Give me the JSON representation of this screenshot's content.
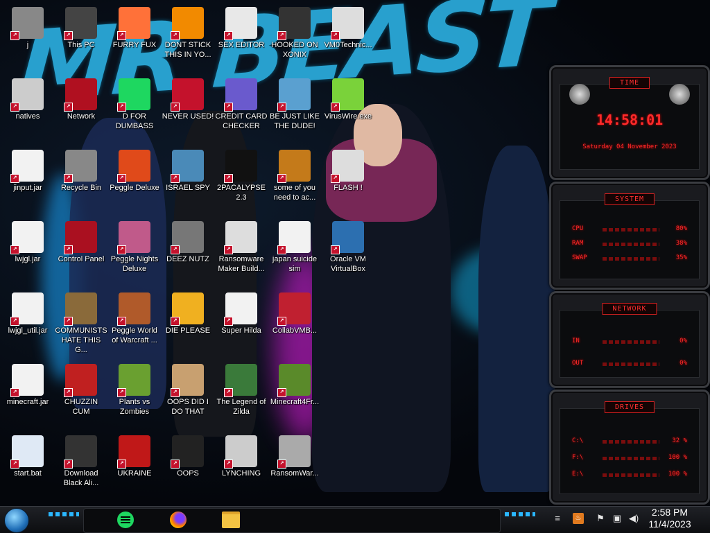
{
  "wallpaper": {
    "title_text": "MR BEAST"
  },
  "desktop_icons": [
    {
      "label": "j"
    },
    {
      "label": "This PC"
    },
    {
      "label": "FURRY FUX"
    },
    {
      "label": "DONT STICK THIS IN YO..."
    },
    {
      "label": "SEX EDITOR"
    },
    {
      "label": "HOOKED ON XONIX"
    },
    {
      "label": "VM0Technic..."
    },
    {
      "label": "natives"
    },
    {
      "label": "Network"
    },
    {
      "label": "D FOR DUMBASS"
    },
    {
      "label": "NEVER USED!"
    },
    {
      "label": "CREDIT CARD CHECKER"
    },
    {
      "label": "BE JUST LIKE THE DUDE!"
    },
    {
      "label": "VirusWire.exe"
    },
    {
      "label": "jinput.jar"
    },
    {
      "label": "Recycle Bin"
    },
    {
      "label": "Peggle Deluxe"
    },
    {
      "label": "ISRAEL SPY"
    },
    {
      "label": "2PACALYPSE 2.3"
    },
    {
      "label": "some of you need to ac..."
    },
    {
      "label": "FLASH !"
    },
    {
      "label": "lwjgl.jar"
    },
    {
      "label": "Control Panel"
    },
    {
      "label": "Peggle Nights Deluxe"
    },
    {
      "label": "DEEZ NUTZ"
    },
    {
      "label": "Ransomware Maker Build..."
    },
    {
      "label": "japan suicide sim"
    },
    {
      "label": "Oracle VM VirtualBox"
    },
    {
      "label": "lwjgl_util.jar"
    },
    {
      "label": "COMMUNISTS HATE THIS G..."
    },
    {
      "label": "Peggle World of Warcraft ..."
    },
    {
      "label": "DIE PLEASE"
    },
    {
      "label": "Super Hilda"
    },
    {
      "label": "CollabVMB..."
    },
    {
      "label": "minecraft.jar"
    },
    {
      "label": "CHUZZIN CUM"
    },
    {
      "label": "Plants vs Zombies"
    },
    {
      "label": "OOPS DID I DO THAT"
    },
    {
      "label": "The Legend of Zilda"
    },
    {
      "label": "Minecraft4Fr..."
    },
    {
      "label": "start.bat"
    },
    {
      "label": "Download Black Ali..."
    },
    {
      "label": "UKRAINE"
    },
    {
      "label": "OOPS"
    },
    {
      "label": "LYNCHING"
    },
    {
      "label": "RansomWar..."
    }
  ],
  "gadgets": {
    "time": {
      "title": "TIME",
      "clock": "14:58:01",
      "date": "Saturday 04 November 2023"
    },
    "system": {
      "title": "SYSTEM",
      "rows": [
        {
          "label": "CPU",
          "value": "80%"
        },
        {
          "label": "RAM",
          "value": "38%"
        },
        {
          "label": "SWAP",
          "value": "35%"
        }
      ]
    },
    "network": {
      "title": "NETWORK",
      "rows": [
        {
          "label": "IN",
          "value": "0%"
        },
        {
          "label": "OUT",
          "value": "0%"
        }
      ]
    },
    "drives": {
      "title": "DRIVES",
      "rows": [
        {
          "label": "C:\\",
          "value": "32 %"
        },
        {
          "label": "F:\\",
          "value": "100 %"
        },
        {
          "label": "E:\\",
          "value": "100 %"
        }
      ]
    }
  },
  "taskbar": {
    "clock_time": "2:58 PM",
    "clock_date": "11/4/2023",
    "pinned": [
      "spotify-icon",
      "firefox-icon",
      "file-explorer-icon"
    ],
    "tray_icons": [
      "show-hidden-icon",
      "java-icon",
      "flag-icon",
      "network-icon",
      "volume-icon"
    ]
  },
  "colors": {
    "accent_red": "#ff2a2a",
    "wallpaper_blue": "#2aa8d8",
    "taskbar_bg": "#14161a"
  }
}
